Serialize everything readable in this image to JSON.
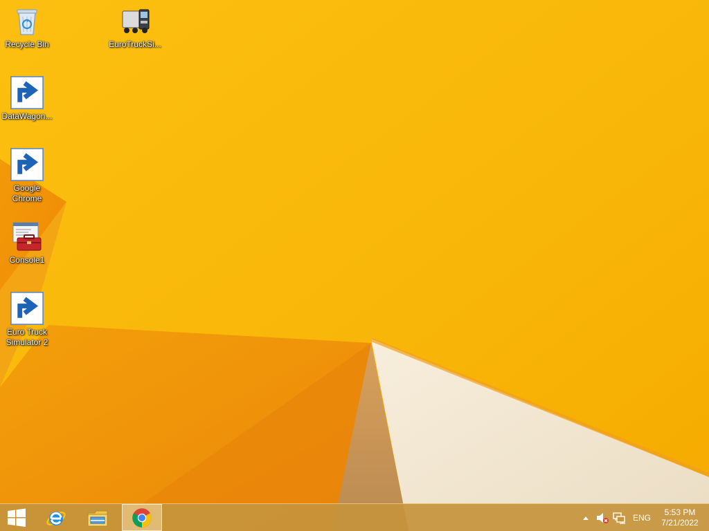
{
  "desktop": {
    "icons": [
      {
        "label": "Recycle Bin",
        "icon": "recycle-bin-icon"
      },
      {
        "label": "EuroTruckSi...",
        "icon": "truck-icon"
      },
      {
        "label": "DataWagon...",
        "icon": "data-wagon-icon"
      },
      {
        "label": "Google Chrome",
        "icon": "chrome-icon"
      },
      {
        "label": "Console1",
        "icon": "toolbox-icon"
      },
      {
        "label": "Euro Truck Simulator 2",
        "icon": "truck-icon"
      }
    ]
  },
  "taskbar": {
    "start": {
      "icon": "windows-logo-icon"
    },
    "pinned": [
      {
        "name": "Internet Explorer",
        "icon": "internet-explorer-icon"
      },
      {
        "name": "File Explorer",
        "icon": "file-explorer-icon"
      },
      {
        "name": "Google Chrome",
        "icon": "chrome-icon",
        "active": true
      }
    ],
    "tray": {
      "show_hidden_icon": "chevron-up-icon",
      "volume_icon": "speaker-muted-icon",
      "network_icon": "network-icon",
      "language": "ENG",
      "time": "5:53 PM",
      "date": "7/21/2022"
    }
  },
  "colors": {
    "wallpaper": "#f7b500",
    "taskbar": "#c6943c"
  }
}
